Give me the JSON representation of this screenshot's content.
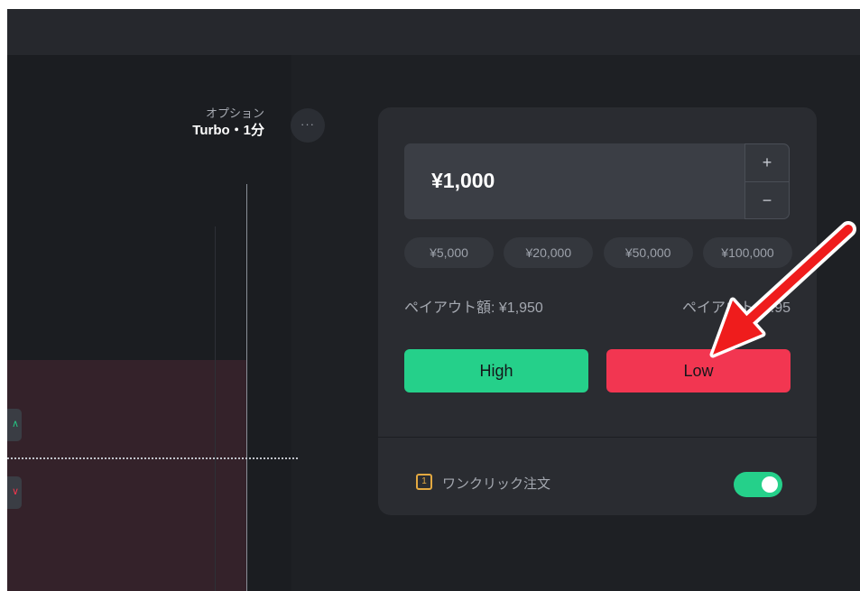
{
  "header": {},
  "option": {
    "label": "オプション",
    "value": "Turbo・1分"
  },
  "more_menu": {
    "label": "···"
  },
  "trade_panel": {
    "amount": "¥1,000",
    "stepper": {
      "plus": "+",
      "minus": "−"
    },
    "presets": [
      "¥5,000",
      "¥20,000",
      "¥50,000",
      "¥100,000"
    ],
    "payout_amount": "ペイアウト額: ¥1,950",
    "payout_rate": "ペイアウト: 1.95",
    "high_label": "High",
    "low_label": "Low",
    "oneclick": {
      "icon_text": "1",
      "label": "ワンクリック注文",
      "enabled": true
    }
  },
  "chart": {
    "up_caret": "^",
    "down_caret": "v"
  },
  "annotation": {
    "icon": "red-arrow-icon",
    "color": "#ef1c1c",
    "points_to": "low-button"
  },
  "colors": {
    "high": "#25d08a",
    "low": "#f23651",
    "panel": "#2a2c31",
    "background": "#1e2024",
    "accent_icon": "#e3a941"
  }
}
